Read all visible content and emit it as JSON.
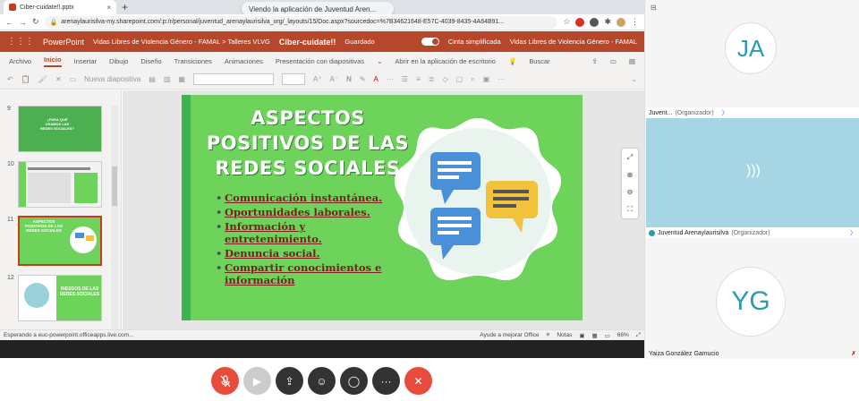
{
  "browser": {
    "tab_title": "Ciber-cuidate!!.pptx",
    "tab_close": "×",
    "new_tab": "+",
    "tooltip": "Viendo la aplicación de Juventud Aren...",
    "url": "arenaylaurisilva-my.sharepoint.com/:p:/r/personal/juventud_arenaylaurisilva_org/_layouts/15/Doc.aspx?sourcedoc=%7B34621648-E57C-4039-8435-4A64B91...",
    "window_controls": [
      "—",
      "□",
      "✕"
    ]
  },
  "ppt_header": {
    "app_name": "PowerPoint",
    "breadcrumb": "Vidas Libres de Violencia Género - FAMAL > Talleres VLVG",
    "doc_title": "Ciber-cuidate!!",
    "save_status": "Guardado",
    "ribbon_toggle_label": "Cinta simplificada",
    "right_title": "Vidas Libres de Violencia Género - FAMAL"
  },
  "ribbon": {
    "tabs": [
      "Archivo",
      "Inicio",
      "Insertar",
      "Dibujo",
      "Diseño",
      "Transiciones",
      "Animaciones",
      "Presentación con diapositivas",
      "Abrir en la aplicación de escritorio",
      "Buscar"
    ],
    "active_tab": "Inicio",
    "new_slide": "Nueva diapositiva"
  },
  "thumbnails": [
    {
      "number": "9",
      "label": "¿PARA QUÉ USAMOS LAS REDES SOCIALES?"
    },
    {
      "number": "10",
      "label": ""
    },
    {
      "number": "11",
      "label": "ASPECTOS POSITIVOS DE LAS REDES SOCIALES"
    },
    {
      "number": "12",
      "label": "RIESGOS DE LAS REDES SOCIALES"
    }
  ],
  "slide": {
    "title": "ASPECTOS POSITIVOS DE LAS REDES SOCIALES",
    "bullets": [
      "Comunicación instantánea.",
      "Oportunidades laborales.",
      "Información y entretenimiento.",
      "Denuncia social.",
      "Compartir conocimientos e información"
    ]
  },
  "status": {
    "left": "Esperando a euc-powerpoint.officeapps.live.com...",
    "help": "Ayude a mejorar Office",
    "notes": "Notas",
    "zoom": "66%"
  },
  "participants": [
    {
      "initials": "JA",
      "name": "Juvent...",
      "role": "(Organizador)"
    },
    {
      "initials": "",
      "name": "Juventud Arenaylaurisilva",
      "role": "(Organizador)"
    },
    {
      "initials": "YG",
      "name": "Yaiza González Gamucio",
      "role": ""
    }
  ],
  "colors": {
    "ppt_brand": "#b7472a",
    "slide_green": "#6dd35b",
    "hangup_red": "#e74c3c",
    "avatar_teal": "#2a9bb0"
  }
}
